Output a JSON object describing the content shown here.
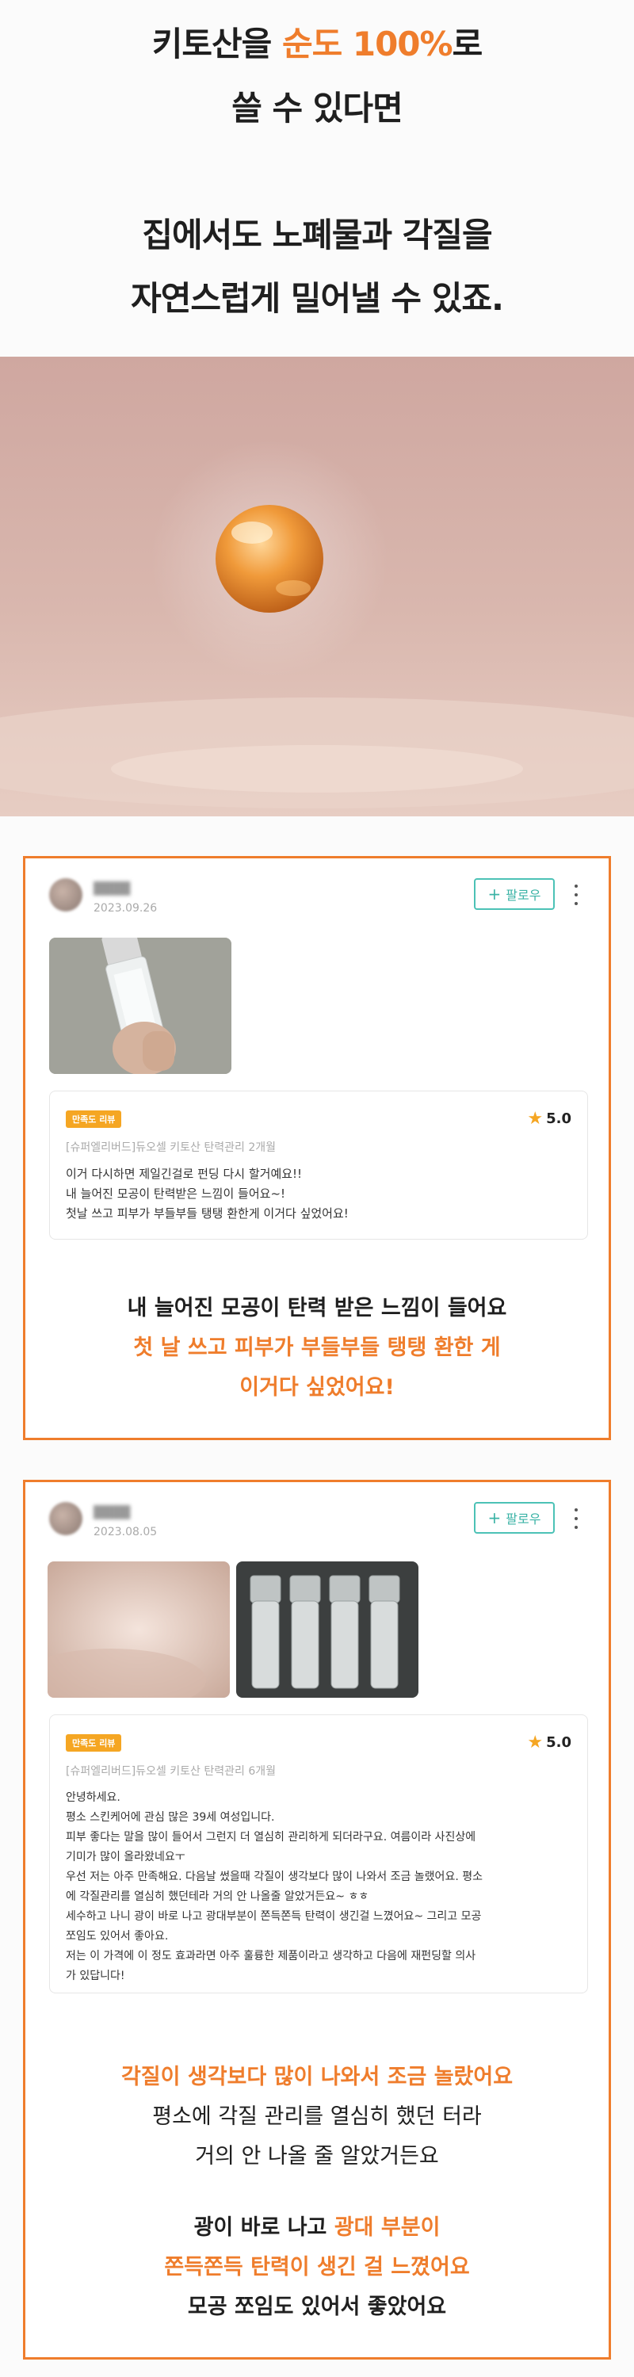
{
  "hero": {
    "line1_pre": "키토산을 ",
    "line1_accent": "순도 100%",
    "line1_post": "로",
    "line2": "쓸 수 있다면",
    "line3": "집에서도 노폐물과 각질을",
    "line4": "자연스럽게 밀어낼 수 있죠."
  },
  "colors": {
    "accent": "#ef7d2c",
    "follow": "#3bb3a6",
    "badge": "#f5a623",
    "star": "#f5a623"
  },
  "reviews": [
    {
      "date": "2023.09.26",
      "follow_label": "팔로우",
      "badge": "만족도 리뷰",
      "rating": "5.0",
      "product": "[슈퍼엘리버드]듀오셀 키토산 탄력관리 2개월",
      "lines": [
        "이거 다시하면 제일긴걸로 펀딩 다시 할거예요!!",
        "내 늘어진 모공이 탄력받은 느낌이 들어요~!",
        "첫날 쓰고 피부가 부들부들 탱탱 환한게 이거다 싶었어요!"
      ],
      "summary": [
        "내 늘어진 모공이 탄력 받은 느낌이 들어요",
        "첫 날 쓰고 피부가 부들부들 탱탱 환한 게",
        "이거다 싶었어요!"
      ]
    },
    {
      "date": "2023.08.05",
      "follow_label": "팔로우",
      "badge": "만족도 리뷰",
      "rating": "5.0",
      "product": "[슈퍼엘리버드]듀오셀 키토산 탄력관리 6개월",
      "lines": [
        "안녕하세요.",
        "평소 스킨케어에 관심 많은 39세 여성입니다.",
        "피부 좋다는 말을 많이 들어서 그런지 더 열심히 관리하게 되더라구요. 여름이라 사진상에",
        "기미가 많이 올라왔네요ㅜ",
        "우선 저는 아주 만족해요. 다음날 썼을때 각질이 생각보다 많이 나와서 조금 놀랬어요. 평소",
        "에 각질관리를 열심히 했던테라 거의 안 나올줄 알았거든요~ ㅎㅎ",
        "세수하고 나니 광이 바로 나고 광대부분이 쫀득쫀득 탄력이 생긴걸 느꼈어요~ 그리고 모공",
        "쪼임도 있어서 좋아요.",
        "저는 이 가격에 이 정도 효과라면 아주 훌륭한 제품이라고 생각하고 다음에 재펀딩할 의사",
        "가 있답니다!"
      ],
      "summary": [
        "각질이 생각보다 많이 나와서 조금 놀랐어요",
        "평소에 각질 관리를 열심히 했던 터라",
        "거의 안 나올 줄 알았거든요",
        "광이 바로 나고 ",
        "광대 부분이",
        "쫀득쫀득 탄력이 생긴 걸 느꼈어요",
        "모공 쪼임도 있어서 좋았어요"
      ]
    }
  ]
}
